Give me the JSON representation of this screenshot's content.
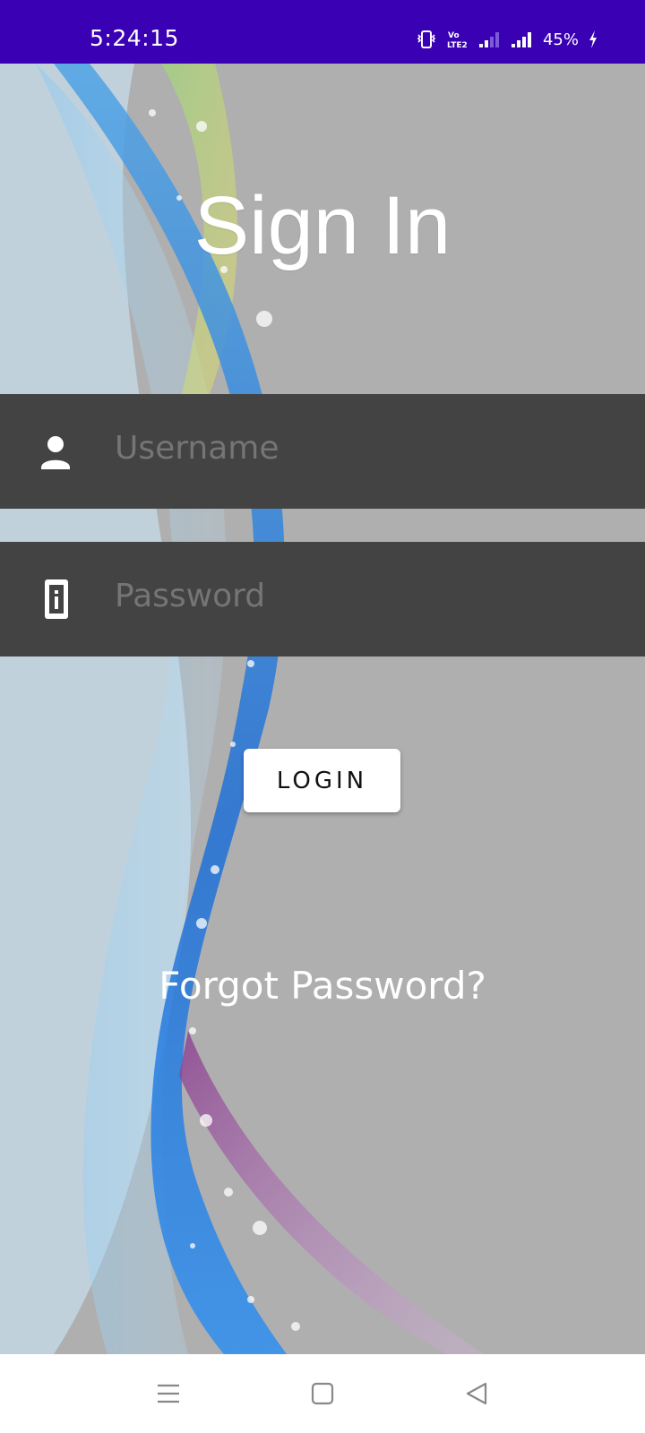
{
  "status_bar": {
    "time": "5:24:15",
    "battery": "45%",
    "icons": [
      "vibrate-icon",
      "volte-icon",
      "signal-icon",
      "signal-icon",
      "charging-icon"
    ]
  },
  "login": {
    "title": "Sign In",
    "username_placeholder": "Username",
    "password_placeholder": "Password",
    "username_icon": "person-icon",
    "password_icon": "badge-icon",
    "login_button": "LOGIN",
    "forgot_link": "Forgot Password?"
  },
  "nav_bar": {
    "icons": [
      "menu-icon",
      "home-icon",
      "back-icon"
    ]
  },
  "colors": {
    "status_bar": "#3a00b3",
    "field_background": "#434343",
    "screen_background": "#afafaf",
    "button_background": "#ffffff"
  }
}
